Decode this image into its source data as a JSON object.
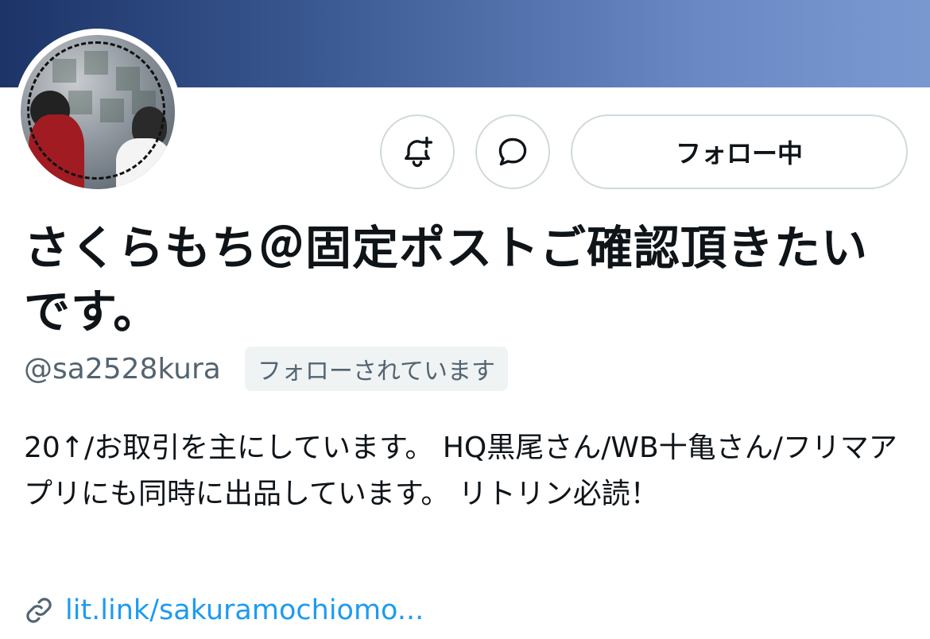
{
  "profile": {
    "display_name": "さくらもち＠固定ポストご確認頂きたいです。",
    "handle": "@sa2528kura",
    "follows_you_badge": "フォローされています",
    "bio": "20↑/お取引を主にしています。 HQ黒尾さん/WB十亀さん/フリマアプリにも同時に出品しています。 リトリン必読！",
    "link": "lit.link/sakuramochiomo..."
  },
  "actions": {
    "notify_icon": "bell-plus-icon",
    "message_icon": "message-bubble-icon",
    "follow_label": "フォロー中"
  },
  "colors": {
    "banner_start": "#1c3468",
    "banner_end": "#7a98d0",
    "link": "#1d9bf0",
    "secondary_text": "#536471",
    "border": "#cfd9de"
  }
}
